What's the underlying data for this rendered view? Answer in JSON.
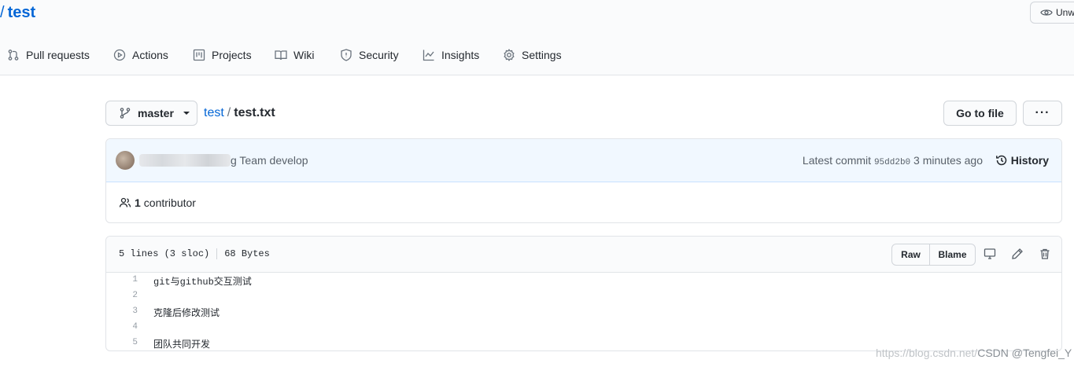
{
  "repo": {
    "separator": "/",
    "name": "test",
    "watch_label": "Unw"
  },
  "nav": {
    "items": [
      {
        "label": "Pull requests",
        "icon": "pull-request-icon"
      },
      {
        "label": "Actions",
        "icon": "play-icon"
      },
      {
        "label": "Projects",
        "icon": "project-icon"
      },
      {
        "label": "Wiki",
        "icon": "book-icon"
      },
      {
        "label": "Security",
        "icon": "shield-icon"
      },
      {
        "label": "Insights",
        "icon": "graph-icon"
      },
      {
        "label": "Settings",
        "icon": "gear-icon"
      }
    ]
  },
  "branch": {
    "name": "master"
  },
  "breadcrumb": {
    "repo": "test",
    "slash": "/",
    "file": "test.txt"
  },
  "buttons": {
    "go_to_file": "Go to file",
    "more": "···"
  },
  "commit": {
    "message_fragment": "g Team develop",
    "latest_label": "Latest commit",
    "sha": "95dd2b0",
    "time": "3 minutes ago",
    "history_label": "History"
  },
  "contributors": {
    "count": "1",
    "label": "contributor"
  },
  "file": {
    "lines_info": "5 lines (3 sloc)",
    "size": "68 Bytes",
    "raw_label": "Raw",
    "blame_label": "Blame",
    "lines": [
      {
        "num": "1",
        "text": "git与github交互测试"
      },
      {
        "num": "2",
        "text": ""
      },
      {
        "num": "3",
        "text": "克隆后修改测试"
      },
      {
        "num": "4",
        "text": ""
      },
      {
        "num": "5",
        "text": "团队共同开发"
      }
    ]
  },
  "watermark": {
    "url": "https://blog.csdn.net/",
    "tag": "CSDN @Tengfei_Y"
  }
}
